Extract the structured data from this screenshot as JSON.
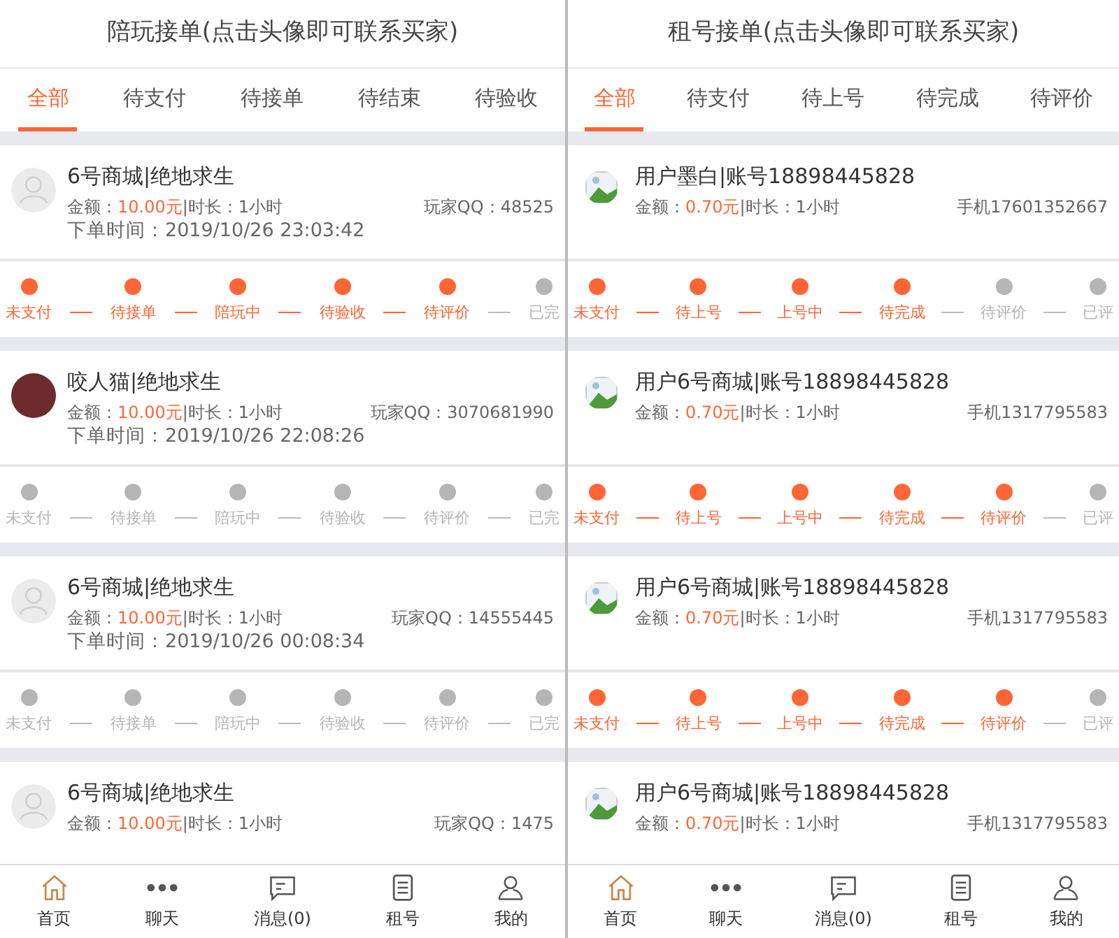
{
  "panels": [
    {
      "title": "陪玩接单(点击头像即可联系买家)",
      "tabs": [
        {
          "label": "全部",
          "selected": true
        },
        {
          "label": "待支付",
          "selected": false
        },
        {
          "label": "待接单",
          "selected": false
        },
        {
          "label": "待结束",
          "selected": false
        },
        {
          "label": "待验收",
          "selected": false
        }
      ],
      "orders": [
        {
          "kind": "default",
          "title": "6号商城|绝地求生",
          "amount_label": "金额：",
          "amount": "10.00元",
          "duration": "|时长：1小时",
          "contact": "玩家QQ：48525",
          "time": "下单时间：2019/10/26 23:03:42",
          "steps": [
            {
              "label": "未支付",
              "done": true
            },
            {
              "label": "待接单",
              "done": true
            },
            {
              "label": "陪玩中",
              "done": true
            },
            {
              "label": "待验收",
              "done": true
            },
            {
              "label": "待评价",
              "done": true
            },
            {
              "label": "已完",
              "done": false
            }
          ]
        },
        {
          "kind": "photo",
          "title": "咬人猫|绝地求生",
          "amount_label": "金额：",
          "amount": "10.00元",
          "duration": "|时长：1小时",
          "contact": "玩家QQ：3070681990",
          "time": "下单时间：2019/10/26 22:08:26",
          "steps": [
            {
              "label": "未支付",
              "done": false
            },
            {
              "label": "待接单",
              "done": false
            },
            {
              "label": "陪玩中",
              "done": false
            },
            {
              "label": "待验收",
              "done": false
            },
            {
              "label": "待评价",
              "done": false
            },
            {
              "label": "已完",
              "done": false
            }
          ]
        },
        {
          "kind": "default",
          "title": "6号商城|绝地求生",
          "amount_label": "金额：",
          "amount": "10.00元",
          "duration": "|时长：1小时",
          "contact": "玩家QQ：14555445",
          "time": "下单时间：2019/10/26 00:08:34",
          "steps": [
            {
              "label": "未支付",
              "done": false
            },
            {
              "label": "待接单",
              "done": false
            },
            {
              "label": "陪玩中",
              "done": false
            },
            {
              "label": "待验收",
              "done": false
            },
            {
              "label": "待评价",
              "done": false
            },
            {
              "label": "已完",
              "done": false
            }
          ]
        },
        {
          "kind": "default",
          "title": "6号商城|绝地求生",
          "amount_label": "金额：",
          "amount": "10.00元",
          "duration": "|时长：1小时",
          "contact": "玩家QQ：1475"
        }
      ],
      "nav": [
        {
          "label": "首页",
          "selected": true
        },
        {
          "label": "聊天",
          "selected": false
        },
        {
          "label": "消息(0)",
          "selected": false
        },
        {
          "label": "租号",
          "selected": false
        },
        {
          "label": "我的",
          "selected": false
        }
      ]
    },
    {
      "title": "租号接单(点击头像即可联系买家)",
      "tabs": [
        {
          "label": "全部",
          "selected": true
        },
        {
          "label": "待支付",
          "selected": false
        },
        {
          "label": "待上号",
          "selected": false
        },
        {
          "label": "待完成",
          "selected": false
        },
        {
          "label": "待评价",
          "selected": false
        }
      ],
      "orders": [
        {
          "kind": "broken",
          "title": "用户墨白|账号18898445828",
          "amount_label": "金额：",
          "amount": "0.70元",
          "duration": "|时长：1小时",
          "contact": "手机17601352667",
          "steps": [
            {
              "label": "未支付",
              "done": true
            },
            {
              "label": "待上号",
              "done": true
            },
            {
              "label": "上号中",
              "done": true
            },
            {
              "label": "待完成",
              "done": true
            },
            {
              "label": "待评价",
              "done": false
            },
            {
              "label": "已评",
              "done": false
            }
          ]
        },
        {
          "kind": "broken",
          "title": "用户6号商城|账号18898445828",
          "amount_label": "金额：",
          "amount": "0.70元",
          "duration": "|时长：1小时",
          "contact": "手机1317795583",
          "steps": [
            {
              "label": "未支付",
              "done": true
            },
            {
              "label": "待上号",
              "done": true
            },
            {
              "label": "上号中",
              "done": true
            },
            {
              "label": "待完成",
              "done": true
            },
            {
              "label": "待评价",
              "done": true
            },
            {
              "label": "已评",
              "done": false
            }
          ]
        },
        {
          "kind": "broken",
          "title": "用户6号商城|账号18898445828",
          "amount_label": "金额：",
          "amount": "0.70元",
          "duration": "|时长：1小时",
          "contact": "手机1317795583",
          "steps": [
            {
              "label": "未支付",
              "done": true
            },
            {
              "label": "待上号",
              "done": true
            },
            {
              "label": "上号中",
              "done": true
            },
            {
              "label": "待完成",
              "done": true
            },
            {
              "label": "待评价",
              "done": true
            },
            {
              "label": "已评",
              "done": false
            }
          ]
        },
        {
          "kind": "broken",
          "title": "用户6号商城|账号18898445828",
          "amount_label": "金额：",
          "amount": "0.70元",
          "duration": "|时长：1小时",
          "contact": "手机1317795583"
        }
      ],
      "nav": [
        {
          "label": "首页",
          "selected": true
        },
        {
          "label": "聊天",
          "selected": false
        },
        {
          "label": "消息(0)",
          "selected": false
        },
        {
          "label": "租号",
          "selected": false
        },
        {
          "label": "我的",
          "selected": false
        }
      ]
    }
  ]
}
